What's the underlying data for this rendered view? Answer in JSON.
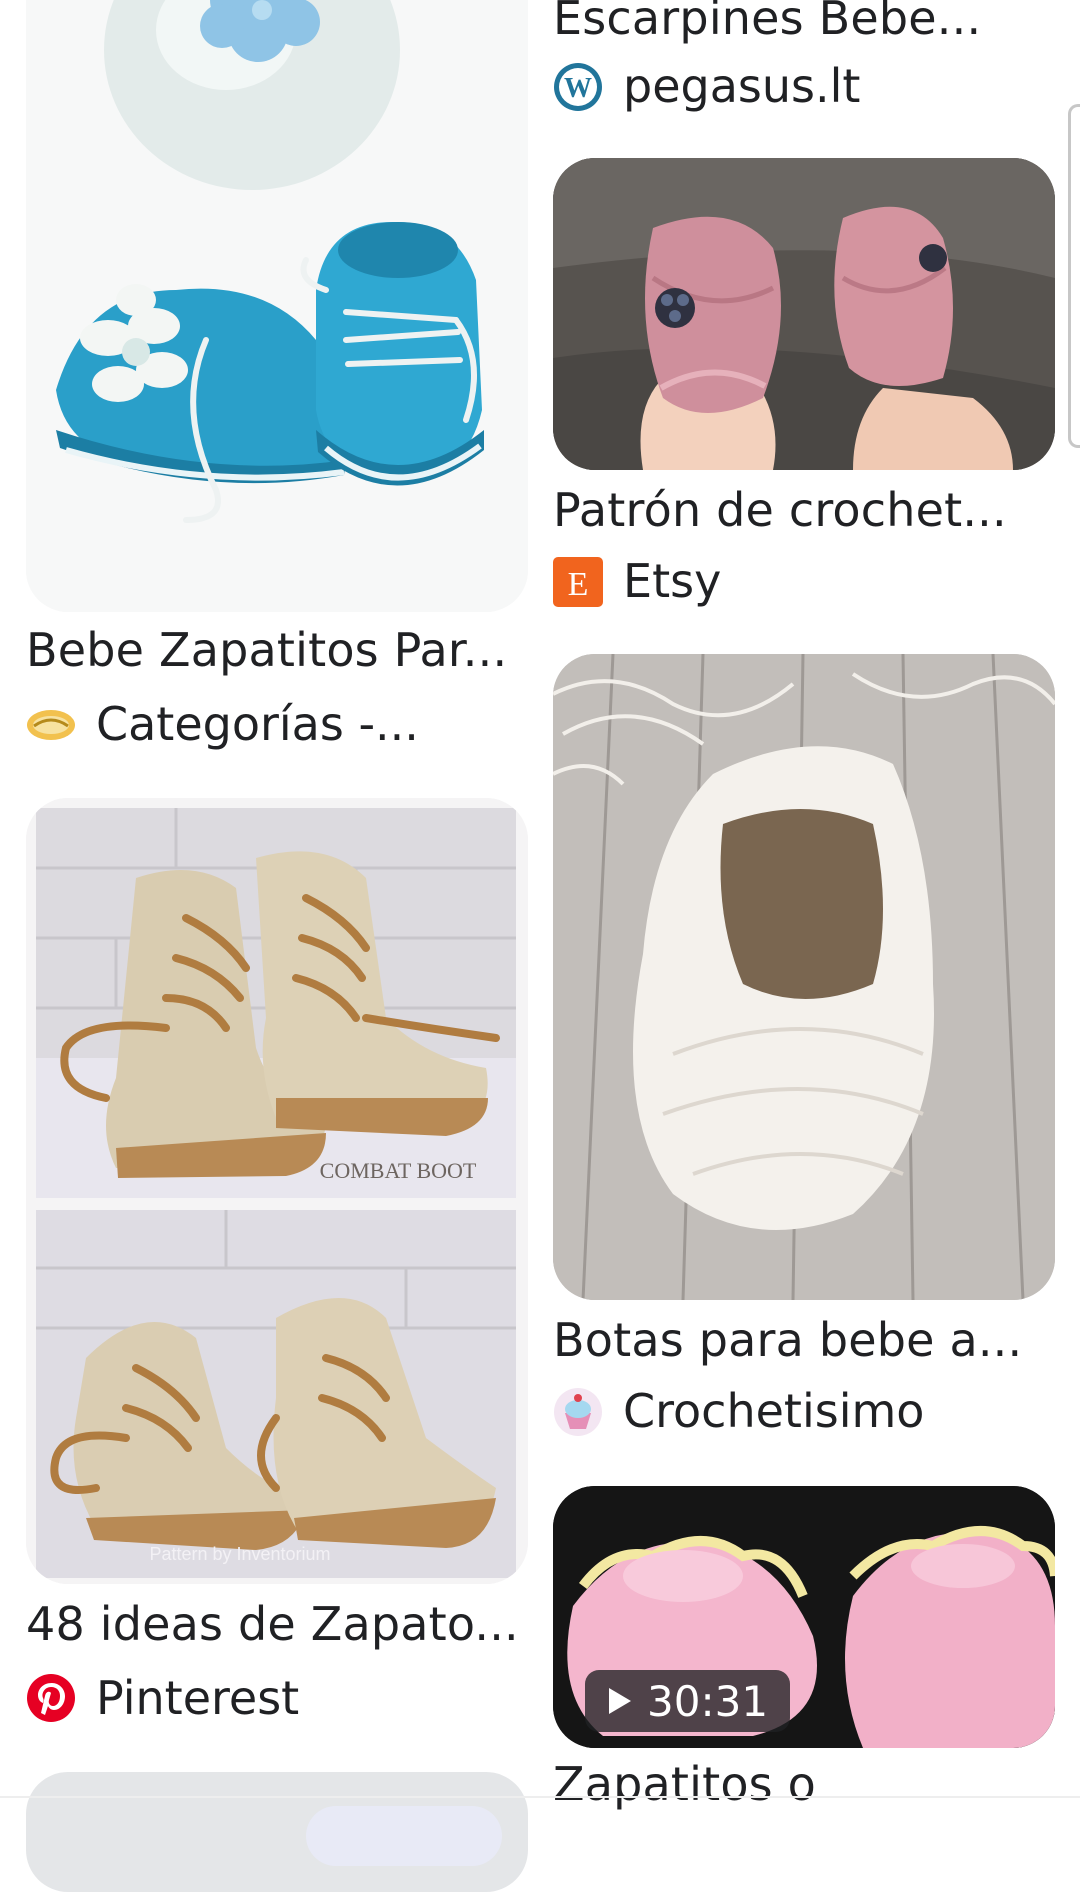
{
  "results": [
    {
      "title": "Escarpines Bebe...",
      "source": "pegasus.lt",
      "source_icon": "wordpress-icon"
    },
    {
      "title": "Bebe Zapatitos Par...",
      "source": "Categorías -...",
      "source_icon": "handshake-icon"
    },
    {
      "title": "Patrón de crochet...",
      "source": "Etsy",
      "source_icon": "etsy-icon"
    },
    {
      "title": "Botas para bebe a...",
      "source": "Crochetisimo",
      "source_icon": "cupcake-icon"
    },
    {
      "title": "48 ideas de Zapato...",
      "source": "Pinterest",
      "source_icon": "pinterest-icon"
    },
    {
      "title": "Zapatitos o",
      "source": "",
      "source_icon": ""
    }
  ],
  "image_texts": {
    "combat_boot": "COMBAT BOOT",
    "pattern_credit": "Pattern by Inventorium"
  },
  "video": {
    "duration": "30:31",
    "icon": "play-icon"
  },
  "colors": {
    "etsy": "#f1641e",
    "pinterest": "#e60023",
    "wordpress": "#21759b"
  }
}
